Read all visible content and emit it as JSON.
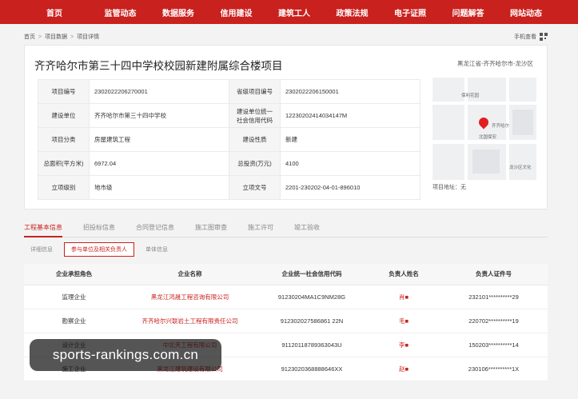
{
  "nav": [
    "首页",
    "监管动态",
    "数据服务",
    "信用建设",
    "建筑工人",
    "政策法规",
    "电子证照",
    "问题解答",
    "网站动态"
  ],
  "breadcrumb": {
    "items": [
      "首页",
      "项目数据",
      "项目详情"
    ],
    "mobile": "手机查看"
  },
  "project": {
    "title": "齐齐哈尔市第三十四中学校校园新建附属综合楼项目",
    "region": "黑龙江省-齐齐哈尔市-龙沙区",
    "info": [
      [
        {
          "label": "项目编号",
          "value": "2302022206270001"
        },
        {
          "label": "省级项目编号",
          "value": "2302022206150001"
        }
      ],
      [
        {
          "label": "建设单位",
          "value": "齐齐哈尔市第三十四中学校"
        },
        {
          "label": "建设单位统一社会信用代码",
          "value": "12230202414034147M"
        }
      ],
      [
        {
          "label": "项目分类",
          "value": "房屋建筑工程"
        },
        {
          "label": "建设性质",
          "value": "新建"
        }
      ],
      [
        {
          "label": "总面积(平方米)",
          "value": "6972.04"
        },
        {
          "label": "总投资(万元)",
          "value": "4100"
        }
      ],
      [
        {
          "label": "立项级别",
          "value": "地市级"
        },
        {
          "label": "立项文号",
          "value": "2201-230202-04-01-896010"
        }
      ]
    ],
    "map_address": "项目地址：无",
    "map_pois": [
      "保利花园",
      "齐齐哈尔",
      "北国保安",
      "龙沙区文化"
    ]
  },
  "tabs": [
    "工程基本信息",
    "招投标信息",
    "合同登记信息",
    "施工图审查",
    "施工许可",
    "竣工验收"
  ],
  "active_tab": 0,
  "subtabs": [
    "详细信息",
    "参与单位及相关负责人",
    "单体信息"
  ],
  "active_subtab": 1,
  "table": {
    "headers": [
      "企业承担角色",
      "企业名称",
      "企业统一社会信用代码",
      "负责人姓名",
      "负责人证件号"
    ],
    "rows": [
      {
        "role": "监理企业",
        "name": "黑龙江鸿晟工程咨询有限公司",
        "code": "91230204MA1C9NM28G",
        "person": "肖■",
        "id": "232101**********29"
      },
      {
        "role": "勘察企业",
        "name": "齐齐哈尔兴联岩土工程有限责任公司",
        "code": "912302027586861 22N",
        "person": "毛■",
        "id": "220702**********19"
      },
      {
        "role": "设计企业",
        "name": "中北天工程有限公司",
        "code": "91120118789363043U",
        "person": "李■",
        "id": "150203**********14"
      },
      {
        "role": "施工企业",
        "name": "黑龙江建筑建设有限公司",
        "code": "9123020368888646XX",
        "person": "赵■",
        "id": "230106**********1X"
      }
    ]
  },
  "watermark": "sports-rankings.com.cn"
}
